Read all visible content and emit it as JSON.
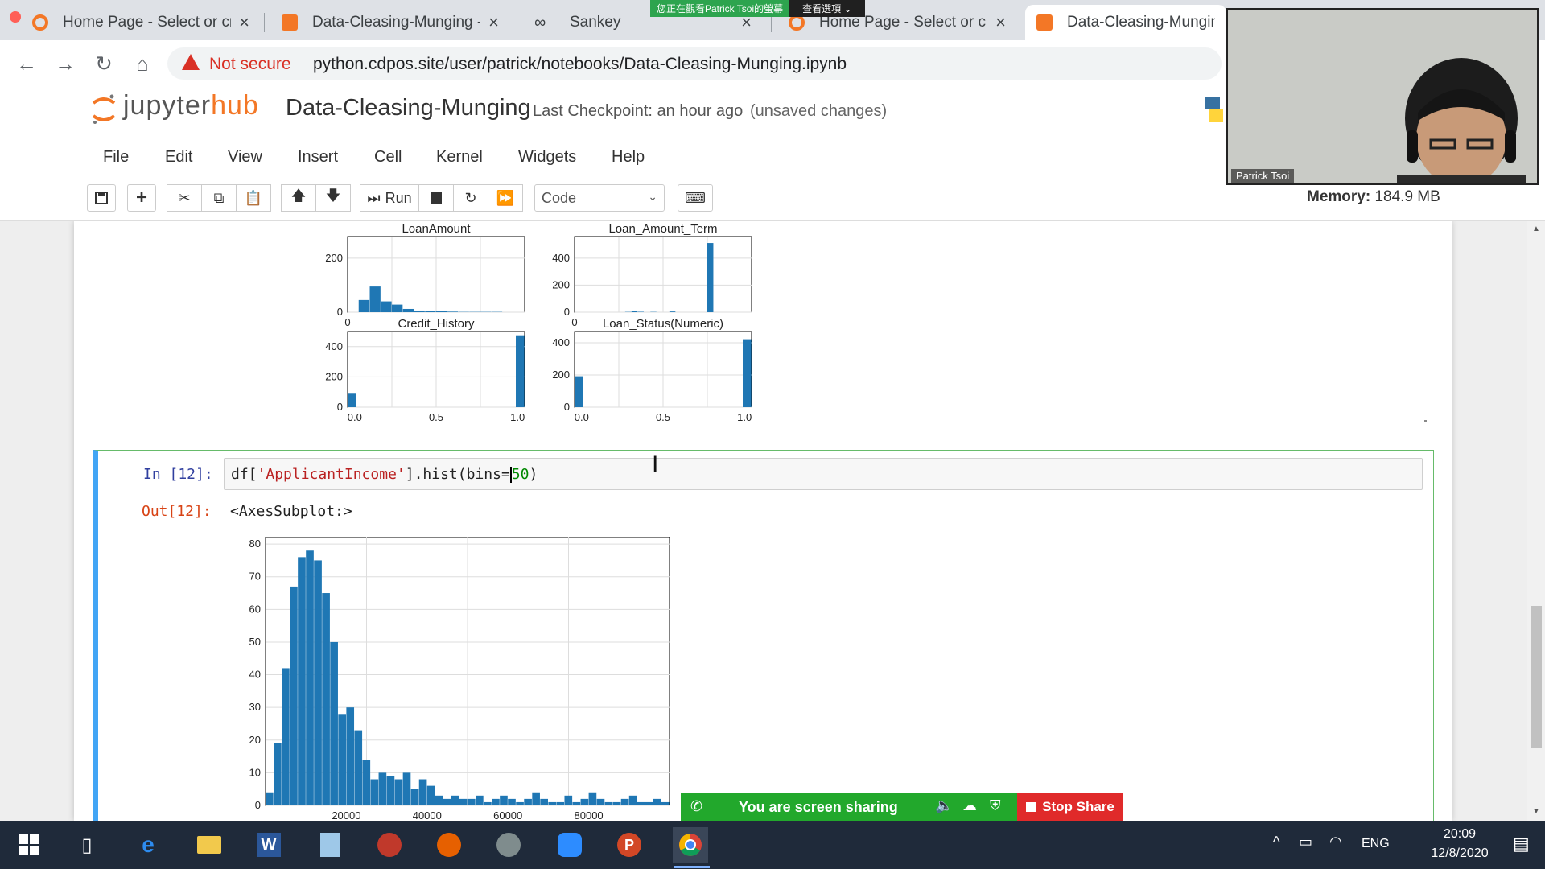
{
  "browser": {
    "tabs": [
      {
        "label": "Home Page - Select or cre",
        "icon": "jupyter-icon",
        "active": false
      },
      {
        "label": "Data-Cleasing-Munging - J",
        "icon": "notebook-icon",
        "active": false
      },
      {
        "label": "Sankey",
        "icon": "link-icon",
        "active": false
      },
      {
        "label": "Home Page - Select or cre",
        "icon": "jupyter-icon",
        "active": false
      },
      {
        "label": "Data-Cleasing-Munging -",
        "icon": "notebook-icon",
        "active": true
      }
    ],
    "address": {
      "security_label": "Not secure",
      "url": "python.cdpos.site/user/patrick/notebooks/Data-Cleasing-Munging.ipynb"
    }
  },
  "share_indicator": {
    "viewing_text": "您正在觀看Patrick Tsoi的螢幕",
    "options_label": "查看選項 ⌄"
  },
  "jupyter": {
    "logo_prefix": "jupyter",
    "logo_suffix": "hub",
    "notebook_title": "Data-Cleasing-Munging",
    "checkpoint": "Last Checkpoint: an hour ago",
    "unsaved": "(unsaved changes)",
    "menu": [
      "File",
      "Edit",
      "View",
      "Insert",
      "Cell",
      "Kernel",
      "Widgets",
      "Help"
    ],
    "toolbar": {
      "run_label": "Run",
      "cell_type": "Code"
    },
    "memory_label": "Memory:",
    "memory_value": "184.9 MB"
  },
  "cell": {
    "in_prompt": "In [12]:",
    "code_prefix": "df[",
    "code_string": "'ApplicantIncome'",
    "code_mid": "].hist(bins=",
    "code_number": "50",
    "code_suffix": ")",
    "out_prompt": "Out[12]:",
    "output_text": "<AxesSubplot:>"
  },
  "chart_data": [
    {
      "type": "bar",
      "title": "LoanAmount",
      "y_ticks": [
        "0",
        "200"
      ],
      "x_ticks": [
        "0"
      ],
      "bins": [
        0,
        45,
        95,
        40,
        28,
        12,
        6,
        4,
        3,
        2,
        1,
        1,
        1,
        1,
        0,
        0
      ],
      "ylim": [
        0,
        280
      ]
    },
    {
      "type": "bar",
      "title": "Loan_Amount_Term",
      "y_ticks": [
        "0",
        "200",
        "400"
      ],
      "x_ticks": [
        "0"
      ],
      "bins": [
        0,
        0,
        0,
        0,
        0,
        0,
        0,
        0,
        2,
        10,
        3,
        0,
        2,
        0,
        0,
        5,
        0,
        0,
        0,
        0,
        0,
        512,
        0,
        0,
        0,
        0,
        0,
        0
      ],
      "ylim": [
        0,
        560
      ]
    },
    {
      "type": "bar",
      "title": "Credit_History",
      "x_ticks": [
        "0.0",
        "0.5",
        "1.0"
      ],
      "y_ticks": [
        "0",
        "200",
        "400"
      ],
      "bins": [
        89,
        0,
        0,
        0,
        0,
        0,
        0,
        0,
        0,
        0,
        0,
        0,
        0,
        0,
        0,
        0,
        0,
        0,
        0,
        475
      ],
      "ylim": [
        0,
        500
      ]
    },
    {
      "type": "bar",
      "title": "Loan_Status(Numeric)",
      "x_ticks": [
        "0.0",
        "0.5",
        "1.0"
      ],
      "y_ticks": [
        "0",
        "200",
        "400"
      ],
      "bins": [
        192,
        0,
        0,
        0,
        0,
        0,
        0,
        0,
        0,
        0,
        0,
        0,
        0,
        0,
        0,
        0,
        0,
        0,
        0,
        422
      ],
      "ylim": [
        0,
        470
      ]
    },
    {
      "type": "bar",
      "title": "",
      "xlabel": "",
      "ylabel": "",
      "y_ticks": [
        "0",
        "10",
        "20",
        "30",
        "40",
        "50",
        "60",
        "70",
        "80"
      ],
      "x_ticks": [
        "20000",
        "40000",
        "60000",
        "80000"
      ],
      "xlim": [
        0,
        100000
      ],
      "ylim": [
        0,
        82
      ],
      "bin_width": 1620,
      "bins": [
        4,
        19,
        42,
        67,
        76,
        78,
        75,
        65,
        50,
        28,
        30,
        23,
        14,
        8,
        10,
        9,
        8,
        10,
        5,
        8,
        6,
        3,
        2,
        3,
        2,
        2,
        3,
        1,
        2,
        3,
        2,
        1,
        2,
        4,
        2,
        1,
        1,
        3,
        1,
        2,
        4,
        2,
        1,
        1,
        2,
        3,
        1,
        1,
        2,
        1
      ],
      "grid": true
    }
  ],
  "screen_share": {
    "status_label": "You are screen sharing",
    "stop_label": "Stop Share"
  },
  "webcam": {
    "name": "Patrick Tsoi"
  },
  "taskbar": {
    "language": "ENG",
    "time": "20:09",
    "date": "12/8/2020"
  }
}
